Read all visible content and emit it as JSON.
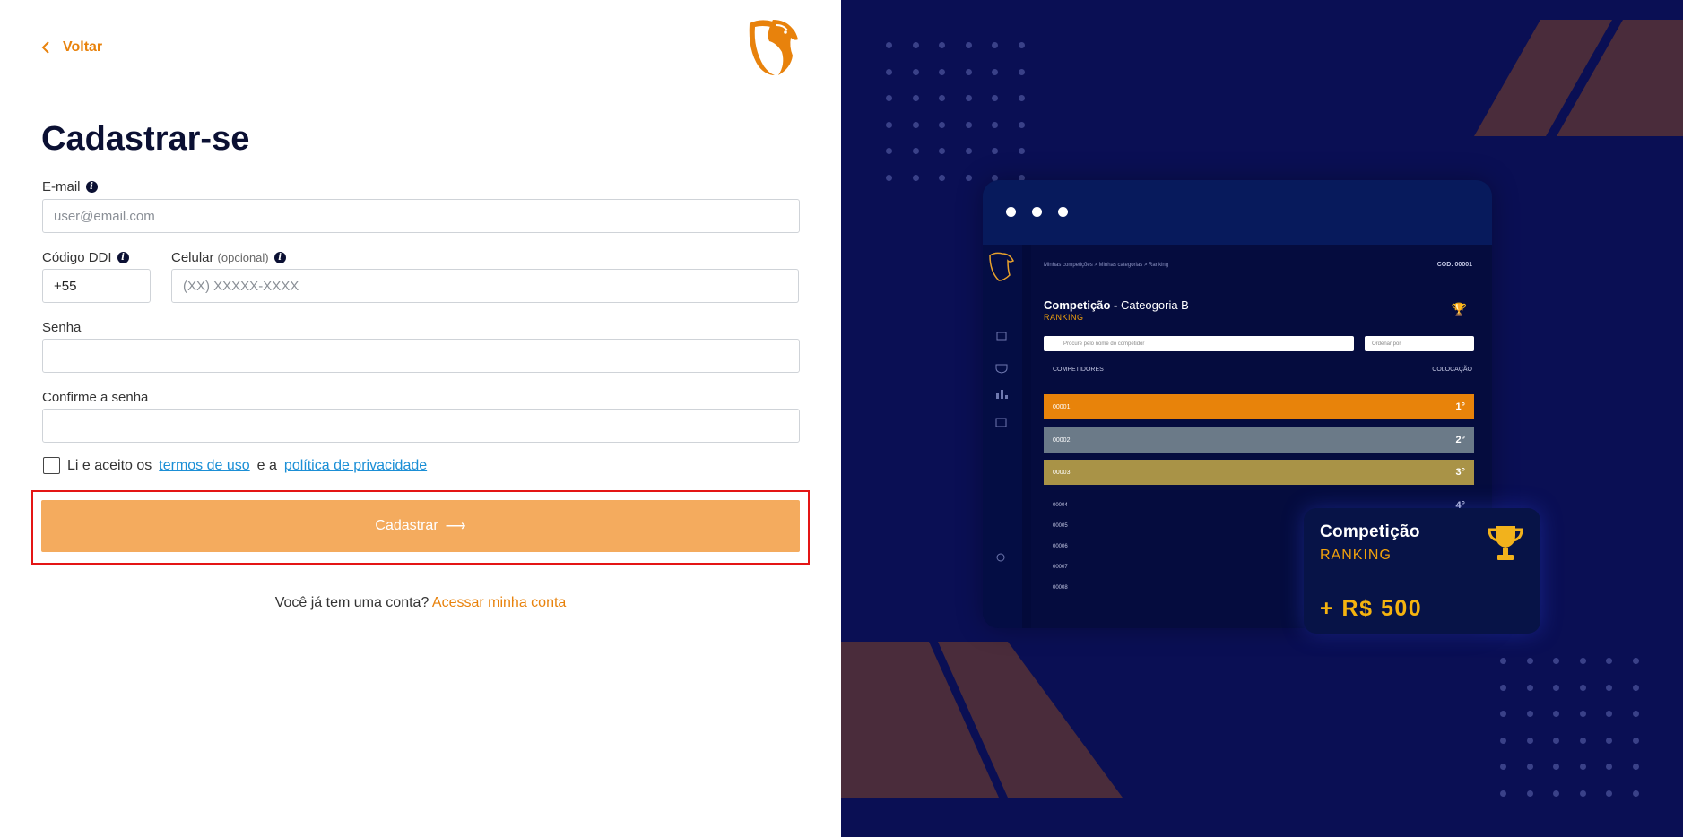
{
  "nav": {
    "back_label": "Voltar"
  },
  "form": {
    "title": "Cadastrar-se",
    "email": {
      "label": "E-mail",
      "placeholder": "user@email.com"
    },
    "ddi": {
      "label": "Código DDI",
      "value": "+55"
    },
    "phone": {
      "label": "Celular",
      "optional": "(opcional)",
      "placeholder": "(XX) XXXXX-XXXX"
    },
    "password": {
      "label": "Senha"
    },
    "confirm": {
      "label": "Confirme a senha"
    },
    "terms": {
      "prefix": "Li e aceito os",
      "terms_link": "termos de uso",
      "middle": "e a",
      "privacy_link": "política de privacidade"
    },
    "submit_label": "Cadastrar",
    "submit_arrow": "⟶",
    "login_prompt": "Você já tem uma conta?",
    "login_link": "Acessar minha conta"
  },
  "promo": {
    "breadcrumb": "Minhas competições  >  Minhas categorias  >  Ranking",
    "cod": "COD: 00001",
    "competition": "Competição -",
    "category": "Cateogoria B",
    "ranking": "RANKING",
    "search_placeholder": "Procure pelo nome do competidor",
    "sort_placeholder": "Ordenar por",
    "col_left": "COMPETIDORES",
    "col_right": "COLOCAÇÃO",
    "rows": [
      {
        "id": "00001",
        "place": "1°",
        "color": "#e8830a"
      },
      {
        "id": "00002",
        "place": "2°",
        "color": "#6b7a88"
      },
      {
        "id": "00003",
        "place": "3°",
        "color": "#a99347"
      },
      {
        "id": "00004",
        "place": "4°"
      },
      {
        "id": "00005"
      },
      {
        "id": "00006"
      },
      {
        "id": "00007"
      },
      {
        "id": "00008"
      }
    ],
    "card": {
      "title": "Competição",
      "subtitle": "RANKING",
      "prize": "+ R$ 500"
    }
  },
  "colors": {
    "accent": "#e8820c",
    "button": "#f4ab5e",
    "link": "#1b8fd6",
    "panel": "#0a0f54",
    "highlight": "#e41515"
  }
}
